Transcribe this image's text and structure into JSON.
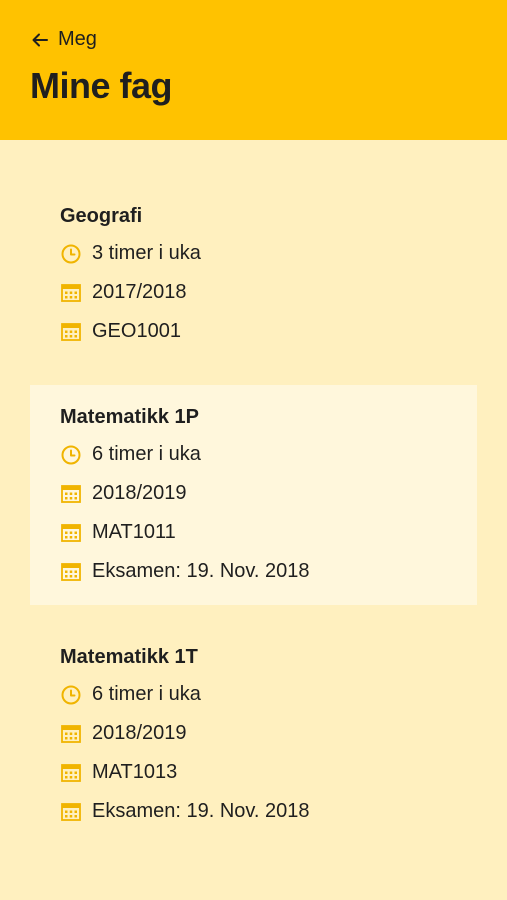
{
  "header": {
    "back_label": "Meg",
    "title": "Mine fag"
  },
  "colors": {
    "accent": "#ffc200",
    "background": "#fff0bf",
    "highlight_card": "#fff7dc",
    "icon": "#f0b400"
  },
  "courses": [
    {
      "name": "Geografi",
      "hours": "3 timer i uka",
      "year": "2017/2018",
      "code": "GEO1001"
    },
    {
      "name": "Matematikk 1P",
      "hours": "6 timer i uka",
      "year": "2018/2019",
      "code": "MAT1011",
      "exam": "Eksamen: 19. Nov. 2018"
    },
    {
      "name": "Matematikk 1T",
      "hours": "6 timer i uka",
      "year": "2018/2019",
      "code": "MAT1013",
      "exam": "Eksamen: 19. Nov. 2018"
    }
  ]
}
